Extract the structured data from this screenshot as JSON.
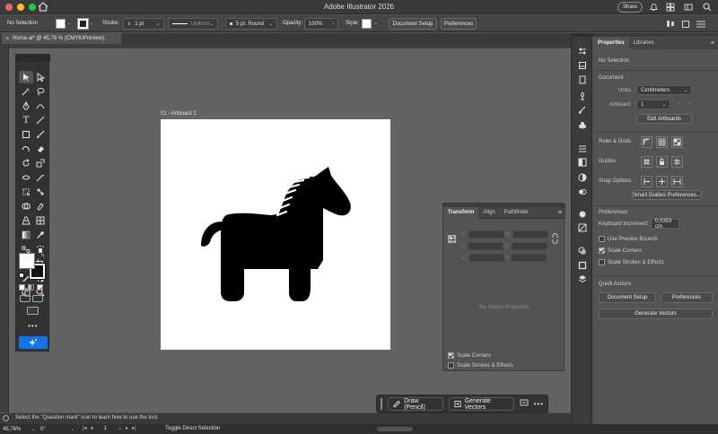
{
  "app_title": "Adobe Illustrator 2026",
  "title_bar": {
    "share_label": "Share"
  },
  "control_bar": {
    "selection": "No Selection",
    "stroke_label": "Stroke:",
    "stroke_weight": "1 pt",
    "profile": "Uniform",
    "brush": "5 pt. Round",
    "opacity_label": "Opacity:",
    "opacity_value": "100%",
    "style_label": "Style:",
    "document_setup": "Document Setup",
    "preferences": "Preferences"
  },
  "document_tab": {
    "title": "Horse.ai* @ 45,76 % (CMYK/Preview)"
  },
  "artboard": {
    "label": "01 - Artboard 1"
  },
  "floating_panel": {
    "tabs": [
      "Transform",
      "Align",
      "Pathfinder"
    ],
    "x_label": "X:",
    "y_label": "Y:",
    "w_label": "W:",
    "h_label": "H:",
    "angle_label": "∠:",
    "shear_label": "⧄:",
    "empty_message": "No Shape Properties",
    "scale_corners": "Scale Corners",
    "scale_strokes": "Scale Strokes & Effects",
    "scale_corners_checked": true,
    "scale_strokes_checked": false
  },
  "context_bar": {
    "draw_label": "Draw (Pencil)",
    "generate_label": "Generate Vectors"
  },
  "properties": {
    "tabs": [
      "Properties",
      "Libraries"
    ],
    "selection": "No Selection",
    "document_heading": "Document",
    "units_label": "Units:",
    "units_value": "Centimeters",
    "artboard_label": "Artboard:",
    "artboard_value": "1",
    "edit_artboards": "Edit Artboards",
    "ruler_grids": "Ruler & Grids",
    "guides": "Guides",
    "snap_options": "Snap Options",
    "smart_guides_prefs": "Smart Guides Preferences...",
    "preferences_heading": "Preferences",
    "keyboard_increment_label": "Keyboard Increment:",
    "keyboard_increment_value": "0,0353 cm",
    "use_preview_bounds": "Use Preview Bounds",
    "scale_corners": "Scale Corners",
    "scale_strokes": "Scale Strokes & Effects",
    "use_preview_bounds_checked": false,
    "scale_corners_checked": true,
    "scale_strokes_checked": false,
    "quick_actions_heading": "Quick Actions",
    "document_setup": "Document Setup",
    "preferences": "Preferences",
    "generate_vectors": "Generate Vectors"
  },
  "hint_bar": {
    "text": "Select the \"Question mark\" icon to learn how to use the tool."
  },
  "status_bar": {
    "zoom": "45,76%",
    "rotation": "0°",
    "artboard_nav": "1",
    "tool_name": "Toggle Direct Selection"
  },
  "colors": {
    "accent": "#1473e6",
    "panel": "#535353",
    "canvas": "#6a6a6a",
    "dark": "#323232"
  }
}
